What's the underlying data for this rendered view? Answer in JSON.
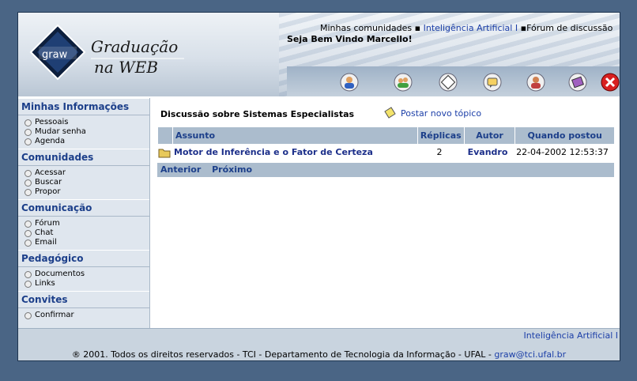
{
  "header": {
    "logo_line1": "Graduação",
    "logo_line2": "na WEB",
    "logo_mark": "graw",
    "breadcrumb": {
      "part1": "Minhas comunidades",
      "sep1": "▪",
      "part2": "Inteligência Artificial I",
      "sep2": "▪",
      "part3": "Fórum de discussão"
    },
    "welcome": "Seja Bem Vindo Marcello!",
    "toolbar_icons": [
      "user-profile-icon",
      "people-icon",
      "window-icon",
      "chat-icon",
      "user-info-icon",
      "book-icon",
      "close-icon"
    ]
  },
  "sidebar": {
    "sections": [
      {
        "title": "Minhas Informações",
        "items": [
          "Pessoais",
          "Mudar senha",
          "Agenda"
        ]
      },
      {
        "title": "Comunidades",
        "items": [
          "Acessar",
          "Buscar",
          "Propor"
        ]
      },
      {
        "title": "Comunicação",
        "items": [
          "Fórum",
          "Chat",
          "Email"
        ]
      },
      {
        "title": "Pedagógico",
        "items": [
          "Documentos",
          "Links"
        ]
      },
      {
        "title": "Convites",
        "items": [
          "Confirmar"
        ]
      }
    ]
  },
  "main": {
    "title": "Discussão sobre Sistemas Especialistas",
    "post_new": "Postar novo tópico",
    "columns": {
      "subject": "Assunto",
      "replies": "Réplicas",
      "author": "Autor",
      "posted": "Quando postou"
    },
    "rows": [
      {
        "subject": "Motor de Inferência e o Fator de Certeza",
        "replies": "2",
        "author": "Evandro",
        "posted": "22-04-2002 12:53:37"
      }
    ],
    "prev": "Anterior",
    "next": "Próximo"
  },
  "footer": {
    "community_link": "Inteligência Artificial I",
    "copyright": "® 2001. Todos os direitos reservados - TCI - Departamento de Tecnologia da Informação - UFAL - ",
    "email": "graw@tci.ufal.br"
  }
}
